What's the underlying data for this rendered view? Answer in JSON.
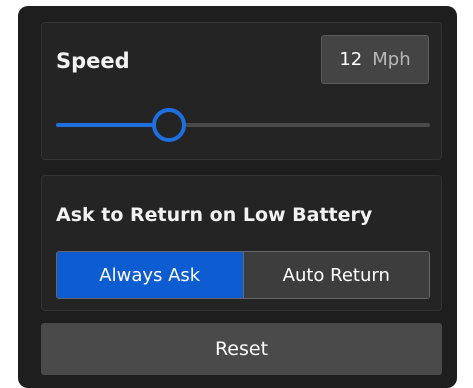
{
  "speed": {
    "title": "Speed",
    "value": "12",
    "unit": "Mph",
    "slider_fraction": 0.3
  },
  "battery": {
    "title": "Ask to Return on Low Battery",
    "options": [
      "Always Ask",
      "Auto Return"
    ],
    "selected_index": 0
  },
  "reset": {
    "label": "Reset"
  },
  "colors": {
    "accent": "#1e6fe0",
    "selected_segment": "#0d5cd1",
    "panel_bg": "#1e1e1e",
    "card_bg": "#242424"
  }
}
